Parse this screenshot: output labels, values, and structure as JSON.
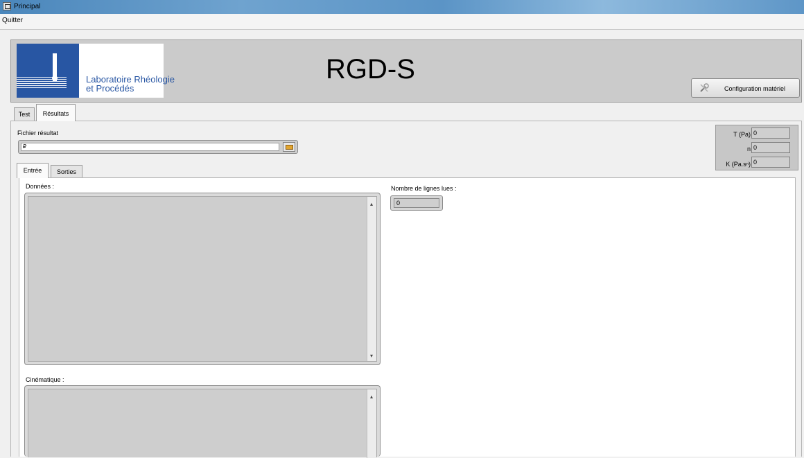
{
  "window": {
    "title": "Principal"
  },
  "menu": {
    "quit": "Quitter"
  },
  "header": {
    "logo_line1": "Laboratoire Rhéologie",
    "logo_line2": "et Procédés",
    "app_name": "RGD-S",
    "config_button": "Configuration matériel"
  },
  "tabs": {
    "test": "Test",
    "resultats": "Résultats"
  },
  "results_file": {
    "label": "Fichier résultat",
    "value": ""
  },
  "params": [
    {
      "label": "T (Pa)",
      "value": "0"
    },
    {
      "label": "n",
      "value": "0"
    },
    {
      "label": "K (Pa.sⁿ)",
      "value": "0"
    }
  ],
  "inner_tabs": {
    "entree": "Entrée",
    "sorties": "Sorties"
  },
  "donnees": {
    "label": "Données :",
    "value": ""
  },
  "cinematique": {
    "label": "Cinématique :",
    "value": ""
  },
  "nb_lignes": {
    "label": "Nombre de lignes lues :",
    "value": "0"
  }
}
